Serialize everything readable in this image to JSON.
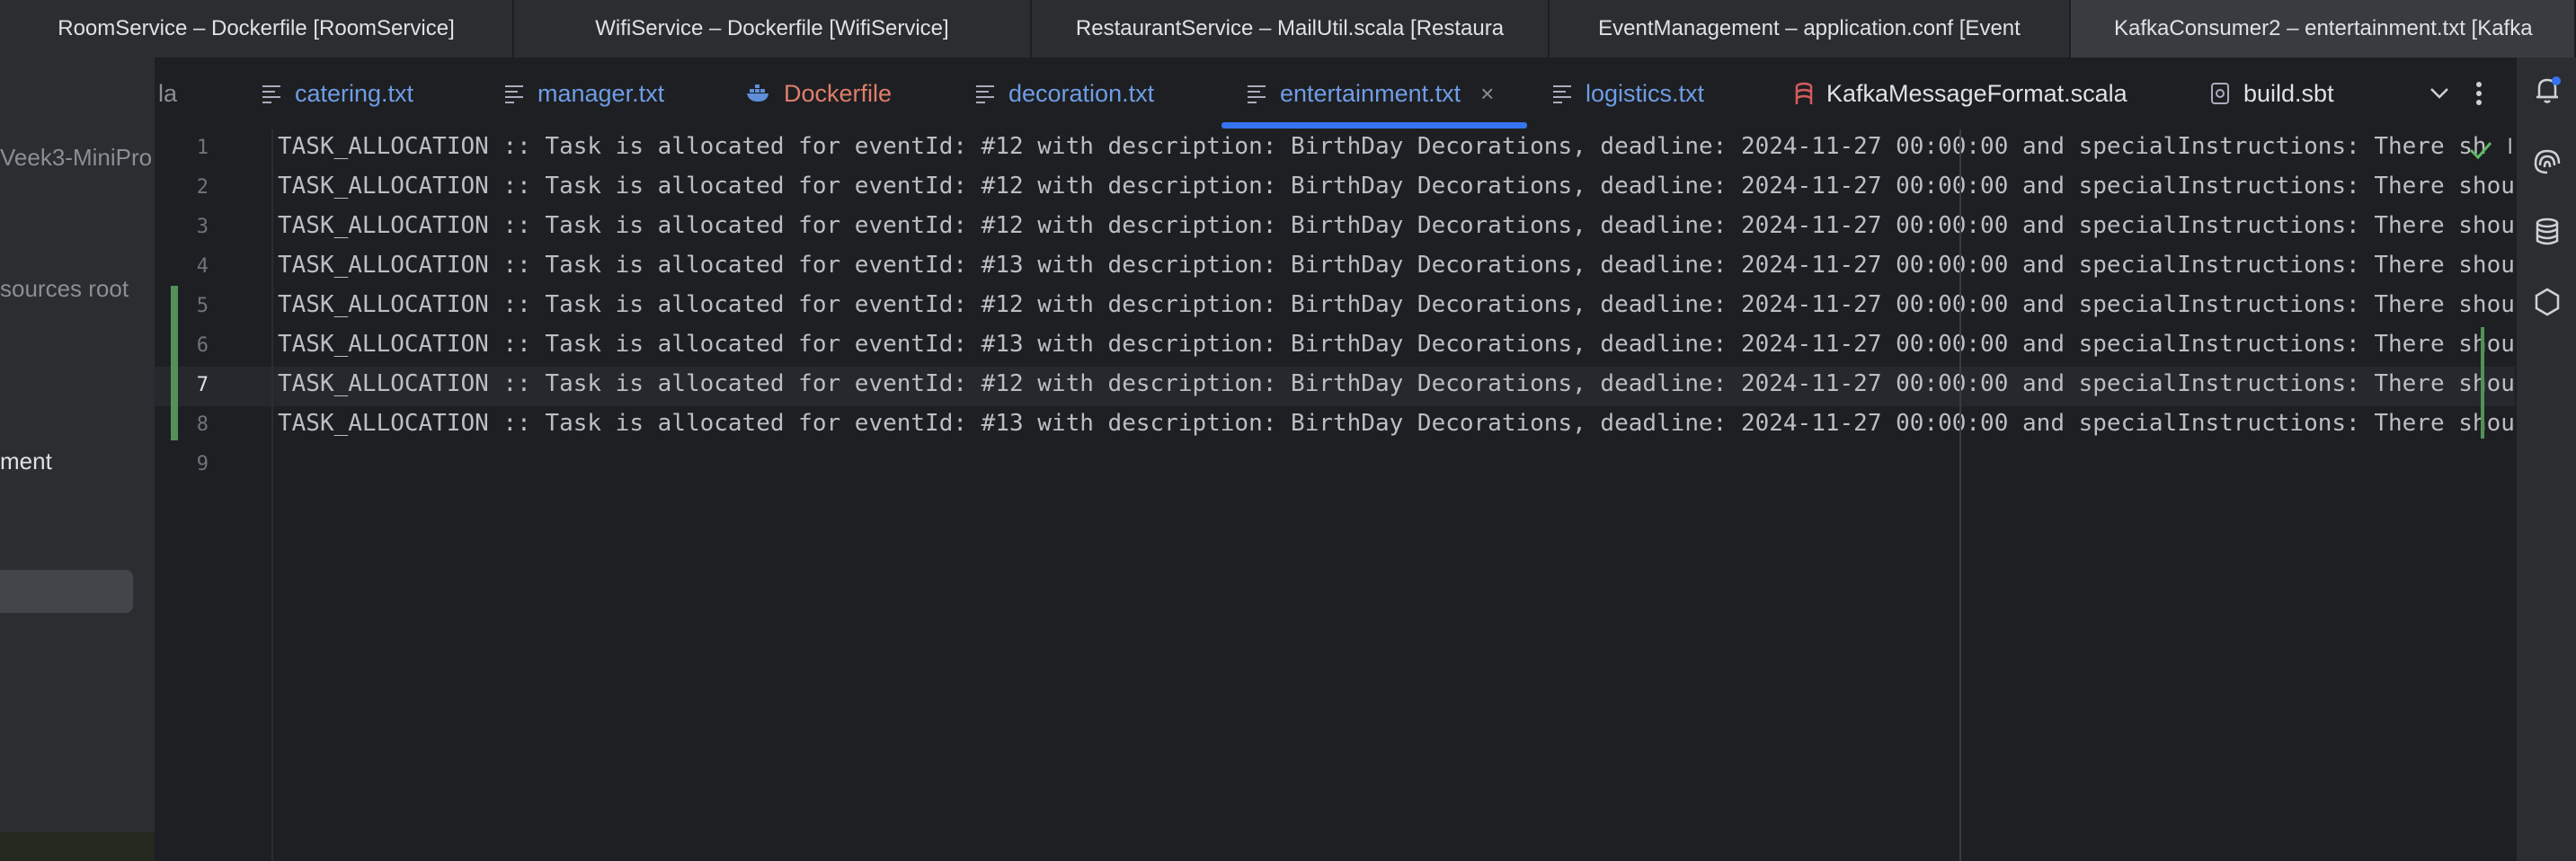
{
  "window_tabs": [
    {
      "label": "RoomService – Dockerfile [RoomService]",
      "active": false
    },
    {
      "label": "WifiService – Dockerfile [WifiService]",
      "active": false
    },
    {
      "label": "RestaurantService – MailUtil.scala [Restaura",
      "active": false
    },
    {
      "label": "EventManagement – application.conf [Event",
      "active": false
    },
    {
      "label": "KafkaConsumer2 – entertainment.txt [Kafka",
      "active": true
    }
  ],
  "project_panel": {
    "partial_texts": [
      "Veek3-MiniPro",
      "sources root",
      "ment"
    ]
  },
  "editor_tabs": [
    {
      "label": "la",
      "icon": "scala-file-icon",
      "color": "#8b8e94"
    },
    {
      "label": "catering.txt",
      "icon": "text-file-icon",
      "color": "#6e9de6"
    },
    {
      "label": "manager.txt",
      "icon": "text-file-icon",
      "color": "#6e9de6"
    },
    {
      "label": "Dockerfile",
      "icon": "docker-icon",
      "color": "#e07e6b"
    },
    {
      "label": "decoration.txt",
      "icon": "text-file-icon",
      "color": "#6e9de6"
    },
    {
      "label": "entertainment.txt",
      "icon": "text-file-icon",
      "color": "#6e9de6",
      "active": true,
      "close": "×"
    },
    {
      "label": "logistics.txt",
      "icon": "text-file-icon",
      "color": "#6e9de6"
    },
    {
      "label": "KafkaMessageFormat.scala",
      "icon": "scala-file-icon",
      "color": "#dfe1e5"
    },
    {
      "label": "build.sbt",
      "icon": "sbt-file-icon",
      "color": "#dfe1e5"
    }
  ],
  "editor": {
    "current_line": 7,
    "line_numbers": [
      "1",
      "2",
      "3",
      "4",
      "5",
      "6",
      "7",
      "8",
      "9"
    ],
    "lines": [
      "TASK_ALLOCATION :: Task is allocated for eventId: #12 with description: BirthDay Decorations, deadline: 2024-11-27 00:00:00 and specialInstructions: There sh",
      "TASK_ALLOCATION :: Task is allocated for eventId: #12 with description: BirthDay Decorations, deadline: 2024-11-27 00:00:00 and specialInstructions: There shoul",
      "TASK_ALLOCATION :: Task is allocated for eventId: #12 with description: BirthDay Decorations, deadline: 2024-11-27 00:00:00 and specialInstructions: There shoul",
      "TASK_ALLOCATION :: Task is allocated for eventId: #13 with description: BirthDay Decorations, deadline: 2024-11-27 00:00:00 and specialInstructions: There shoul",
      "TASK_ALLOCATION :: Task is allocated for eventId: #12 with description: BirthDay Decorations, deadline: 2024-11-27 00:00:00 and specialInstructions: There shoul",
      "TASK_ALLOCATION :: Task is allocated for eventId: #13 with description: BirthDay Decorations, deadline: 2024-11-27 00:00:00 and specialInstructions: There shoul",
      "TASK_ALLOCATION :: Task is allocated for eventId: #12 with description: BirthDay Decorations, deadline: 2024-11-27 00:00:00 and specialInstructions: There shoul",
      "TASK_ALLOCATION :: Task is allocated for eventId: #13 with description: BirthDay Decorations, deadline: 2024-11-27 00:00:00 and specialInstructions: There shoul",
      ""
    ],
    "trailing_partial_text": "l"
  },
  "right_strip_icons": [
    "notifications-icon",
    "ai-assistant-icon",
    "database-icon",
    "plugin-hexagon-icon"
  ],
  "colors": {
    "accent": "#3574f0",
    "change_marker": "#549159",
    "notification_badge": "#3574f0"
  }
}
